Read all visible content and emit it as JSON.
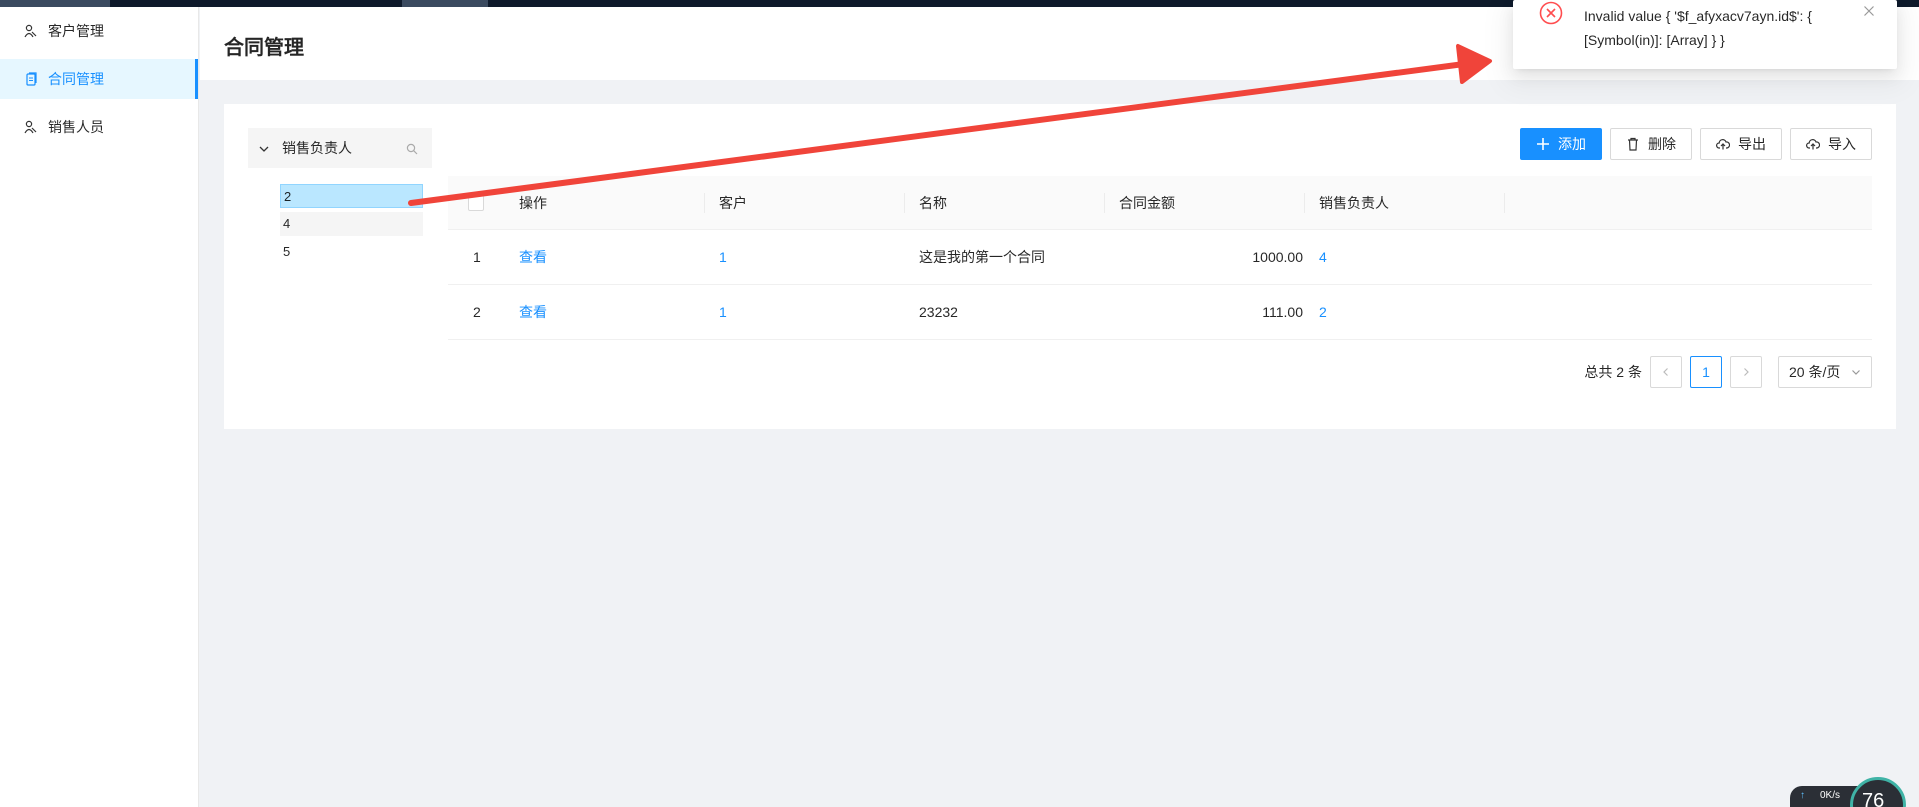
{
  "sidebar": {
    "items": [
      {
        "label": "客户管理",
        "icon": "users-icon",
        "active": false
      },
      {
        "label": "合同管理",
        "icon": "document-icon",
        "active": true
      },
      {
        "label": "销售人员",
        "icon": "users-icon",
        "active": false
      }
    ]
  },
  "header": {
    "title": "合同管理"
  },
  "tree": {
    "title": "销售负责人",
    "nodes": [
      {
        "label": "2",
        "selected": true
      },
      {
        "label": "4",
        "selected": false
      },
      {
        "label": "5",
        "selected": false
      }
    ]
  },
  "toolbar": {
    "add_label": "添加",
    "delete_label": "删除",
    "export_label": "导出",
    "import_label": "导入"
  },
  "table": {
    "columns": [
      "操作",
      "客户",
      "名称",
      "合同金额",
      "销售负责人"
    ],
    "rows": [
      {
        "index": "1",
        "action": "查看",
        "customer": "1",
        "name": "这是我的第一个合同",
        "amount": "1000.00",
        "sales": "4"
      },
      {
        "index": "2",
        "action": "查看",
        "customer": "1",
        "name": "23232",
        "amount": "111.00",
        "sales": "2"
      }
    ]
  },
  "pagination": {
    "total": "总共 2 条",
    "current": "1",
    "page_size": "20 条/页"
  },
  "notification": {
    "message": "Invalid value { '$f_afyxacv7ayn.id$': { [Symbol(in)]: [Array] } }",
    "type": "error"
  },
  "widget": {
    "speed": "0K/s",
    "number": "76"
  },
  "colors": {
    "primary": "#1890ff",
    "error": "#ff4d4f",
    "arrow": "#f0443a",
    "selected_bg": "#bae7ff"
  }
}
